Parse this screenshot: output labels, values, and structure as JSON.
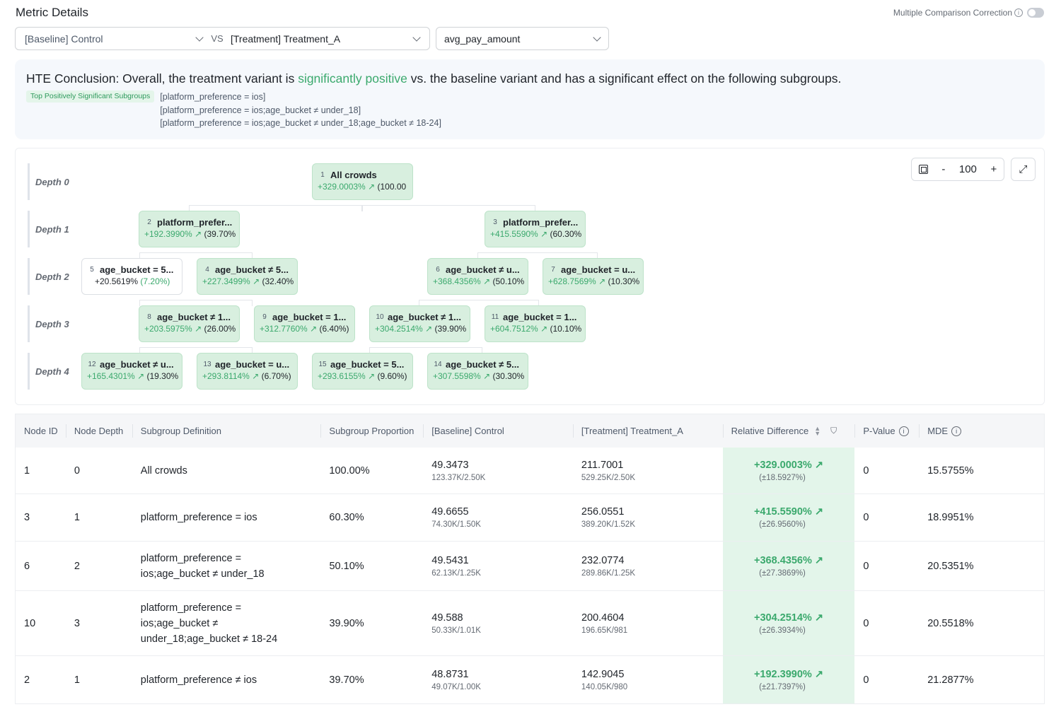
{
  "page_title": "Metric Details",
  "mcc": {
    "label": "Multiple Comparison Correction",
    "enabled": false
  },
  "selectors": {
    "baseline": "[Baseline] Control",
    "vs": "VS",
    "treatment": "[Treatment] Treatment_A",
    "metric": "avg_pay_amount"
  },
  "conclusion": {
    "prefix": "HTE Conclusion: Overall, the treatment variant is ",
    "highlight": "significantly positive",
    "suffix": " vs. the baseline variant and has a significant effect on the following subgroups.",
    "tag": "Top Positively Significant Subgroups",
    "subgroups": [
      "[platform_preference = ios]",
      "[platform_preference = ios;age_bucket ≠ under_18]",
      "[platform_preference = ios;age_bucket ≠ under_18;age_bucket ≠ 18-24]"
    ]
  },
  "tree": {
    "depths": [
      "Depth 0",
      "Depth 1",
      "Depth 2",
      "Depth 3",
      "Depth 4"
    ],
    "zoom": {
      "minus": "-",
      "value": "100",
      "plus": "+"
    },
    "nodes": [
      {
        "id": "1",
        "label": "All crowds",
        "value": "+329.0003%",
        "prop": "(100.00",
        "significant": true
      },
      {
        "id": "2",
        "label": "platform_prefer...",
        "value": "+192.3990%",
        "prop": "(39.70%",
        "significant": true
      },
      {
        "id": "3",
        "label": "platform_prefer...",
        "value": "+415.5590%",
        "prop": "(60.30%",
        "significant": true
      },
      {
        "id": "5",
        "label": "age_bucket = 5...",
        "value": "+20.5619%",
        "prop": "(7.20%)",
        "significant": false
      },
      {
        "id": "4",
        "label": "age_bucket ≠ 5...",
        "value": "+227.3499%",
        "prop": "(32.40%",
        "significant": true
      },
      {
        "id": "6",
        "label": "age_bucket ≠ u...",
        "value": "+368.4356%",
        "prop": "(50.10%",
        "significant": true
      },
      {
        "id": "7",
        "label": "age_bucket = u...",
        "value": "+628.7569%",
        "prop": "(10.30%",
        "significant": true
      },
      {
        "id": "8",
        "label": "age_bucket ≠ 1...",
        "value": "+203.5975%",
        "prop": "(26.00%",
        "significant": true
      },
      {
        "id": "9",
        "label": "age_bucket = 1...",
        "value": "+312.7760%",
        "prop": "(6.40%)",
        "significant": true
      },
      {
        "id": "10",
        "label": "age_bucket ≠ 1...",
        "value": "+304.2514%",
        "prop": "(39.90%",
        "significant": true
      },
      {
        "id": "11",
        "label": "age_bucket = 1...",
        "value": "+604.7512%",
        "prop": "(10.10%",
        "significant": true
      },
      {
        "id": "12",
        "label": "age_bucket ≠ u...",
        "value": "+165.4301%",
        "prop": "(19.30%",
        "significant": true
      },
      {
        "id": "13",
        "label": "age_bucket = u...",
        "value": "+293.8114%",
        "prop": "(6.70%)",
        "significant": true
      },
      {
        "id": "15",
        "label": "age_bucket = 5...",
        "value": "+293.6155%",
        "prop": "(9.60%)",
        "significant": true
      },
      {
        "id": "14",
        "label": "age_bucket ≠ 5...",
        "value": "+307.5598%",
        "prop": "(30.30%",
        "significant": true
      }
    ]
  },
  "table": {
    "headers": [
      "Node ID",
      "Node Depth",
      "Subgroup Definition",
      "Subgroup Proportion",
      "[Baseline] Control",
      "[Treatment] Treatment_A",
      "Relative Difference",
      "P-Value",
      "MDE"
    ],
    "rows": [
      {
        "id": "1",
        "depth": "0",
        "def": "All crowds",
        "prop": "100.00%",
        "base": "49.3473",
        "base_sub": "123.37K/2.50K",
        "treat": "211.7001",
        "treat_sub": "529.25K/2.50K",
        "rel": "+329.0003%",
        "rel_ci": "(±18.5927%)",
        "p": "0",
        "mde": "15.5755%"
      },
      {
        "id": "3",
        "depth": "1",
        "def": "platform_preference = ios",
        "prop": "60.30%",
        "base": "49.6655",
        "base_sub": "74.30K/1.50K",
        "treat": "256.0551",
        "treat_sub": "389.20K/1.52K",
        "rel": "+415.5590%",
        "rel_ci": "(±26.9560%)",
        "p": "0",
        "mde": "18.9951%"
      },
      {
        "id": "6",
        "depth": "2",
        "def": "platform_preference = ios;age_bucket ≠ under_18",
        "prop": "50.10%",
        "base": "49.5431",
        "base_sub": "62.13K/1.25K",
        "treat": "232.0774",
        "treat_sub": "289.86K/1.25K",
        "rel": "+368.4356%",
        "rel_ci": "(±27.3869%)",
        "p": "0",
        "mde": "20.5351%"
      },
      {
        "id": "10",
        "depth": "3",
        "def": "platform_preference = ios;age_bucket ≠ under_18;age_bucket ≠ 18-24",
        "prop": "39.90%",
        "base": "49.588",
        "base_sub": "50.33K/1.01K",
        "treat": "200.4604",
        "treat_sub": "196.65K/981",
        "rel": "+304.2514%",
        "rel_ci": "(±26.3934%)",
        "p": "0",
        "mde": "20.5518%"
      },
      {
        "id": "2",
        "depth": "1",
        "def": "platform_preference ≠ ios",
        "prop": "39.70%",
        "base": "48.8731",
        "base_sub": "49.07K/1.00K",
        "treat": "142.9045",
        "treat_sub": "140.05K/980",
        "rel": "+192.3990%",
        "rel_ci": "(±21.7397%)",
        "p": "0",
        "mde": "21.2877%"
      }
    ]
  }
}
